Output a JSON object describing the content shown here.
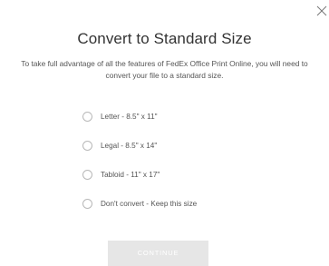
{
  "dialog": {
    "title": "Convert to Standard Size",
    "description": "To take full advantage of all the features of FedEx Office Print Online, you will need to convert your file to a standard size.",
    "close_icon": "close-icon"
  },
  "options": [
    {
      "label": "Letter - 8.5\" x 11\"",
      "selected": false
    },
    {
      "label": "Legal - 8.5\" x 14\"",
      "selected": false
    },
    {
      "label": "Tabloid - 11\" x 17\"",
      "selected": false
    },
    {
      "label": "Don't convert - Keep this size",
      "selected": false
    }
  ],
  "actions": {
    "continue_label": "CONTINUE",
    "continue_enabled": false
  },
  "colors": {
    "title_text": "#333333",
    "body_text": "#555555",
    "radio_border": "#b8b8b8",
    "button_disabled_bg": "#e6e6e6",
    "button_text": "#ffffff"
  }
}
